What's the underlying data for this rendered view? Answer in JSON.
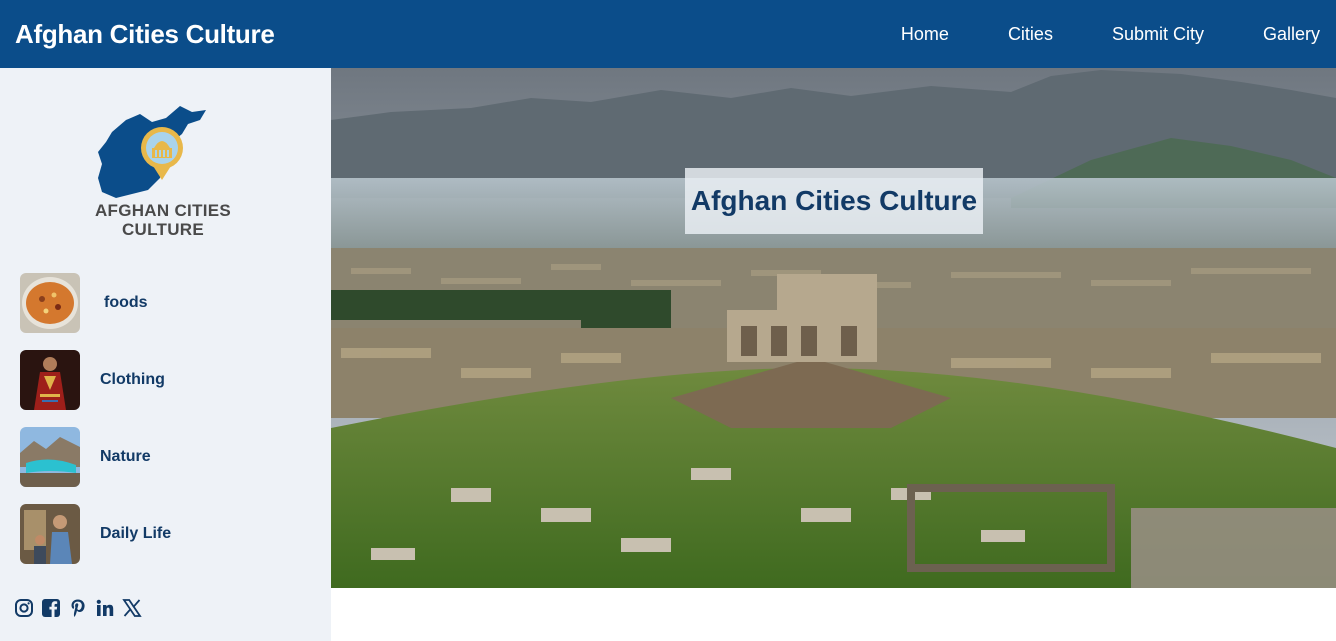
{
  "header": {
    "brand": "Afghan Cities Culture",
    "nav": [
      {
        "label": "Home"
      },
      {
        "label": "Cities"
      },
      {
        "label": "Submit City"
      },
      {
        "label": "Gallery"
      }
    ]
  },
  "sidebar": {
    "logo_text_line1": "AFGHAN CITIES",
    "logo_text_line2": "CULTURE",
    "categories": [
      {
        "label": "foods"
      },
      {
        "label": "Clothing"
      },
      {
        "label": "Nature"
      },
      {
        "label": "Daily Life"
      }
    ],
    "social": [
      "instagram-icon",
      "facebook-icon",
      "pinterest-icon",
      "linkedin-icon",
      "x-icon"
    ]
  },
  "hero": {
    "title": "Afghan Cities Culture"
  },
  "colors": {
    "header_bg": "#0b4d8a",
    "sidebar_bg": "#eef2f7",
    "accent_text": "#123a66"
  }
}
